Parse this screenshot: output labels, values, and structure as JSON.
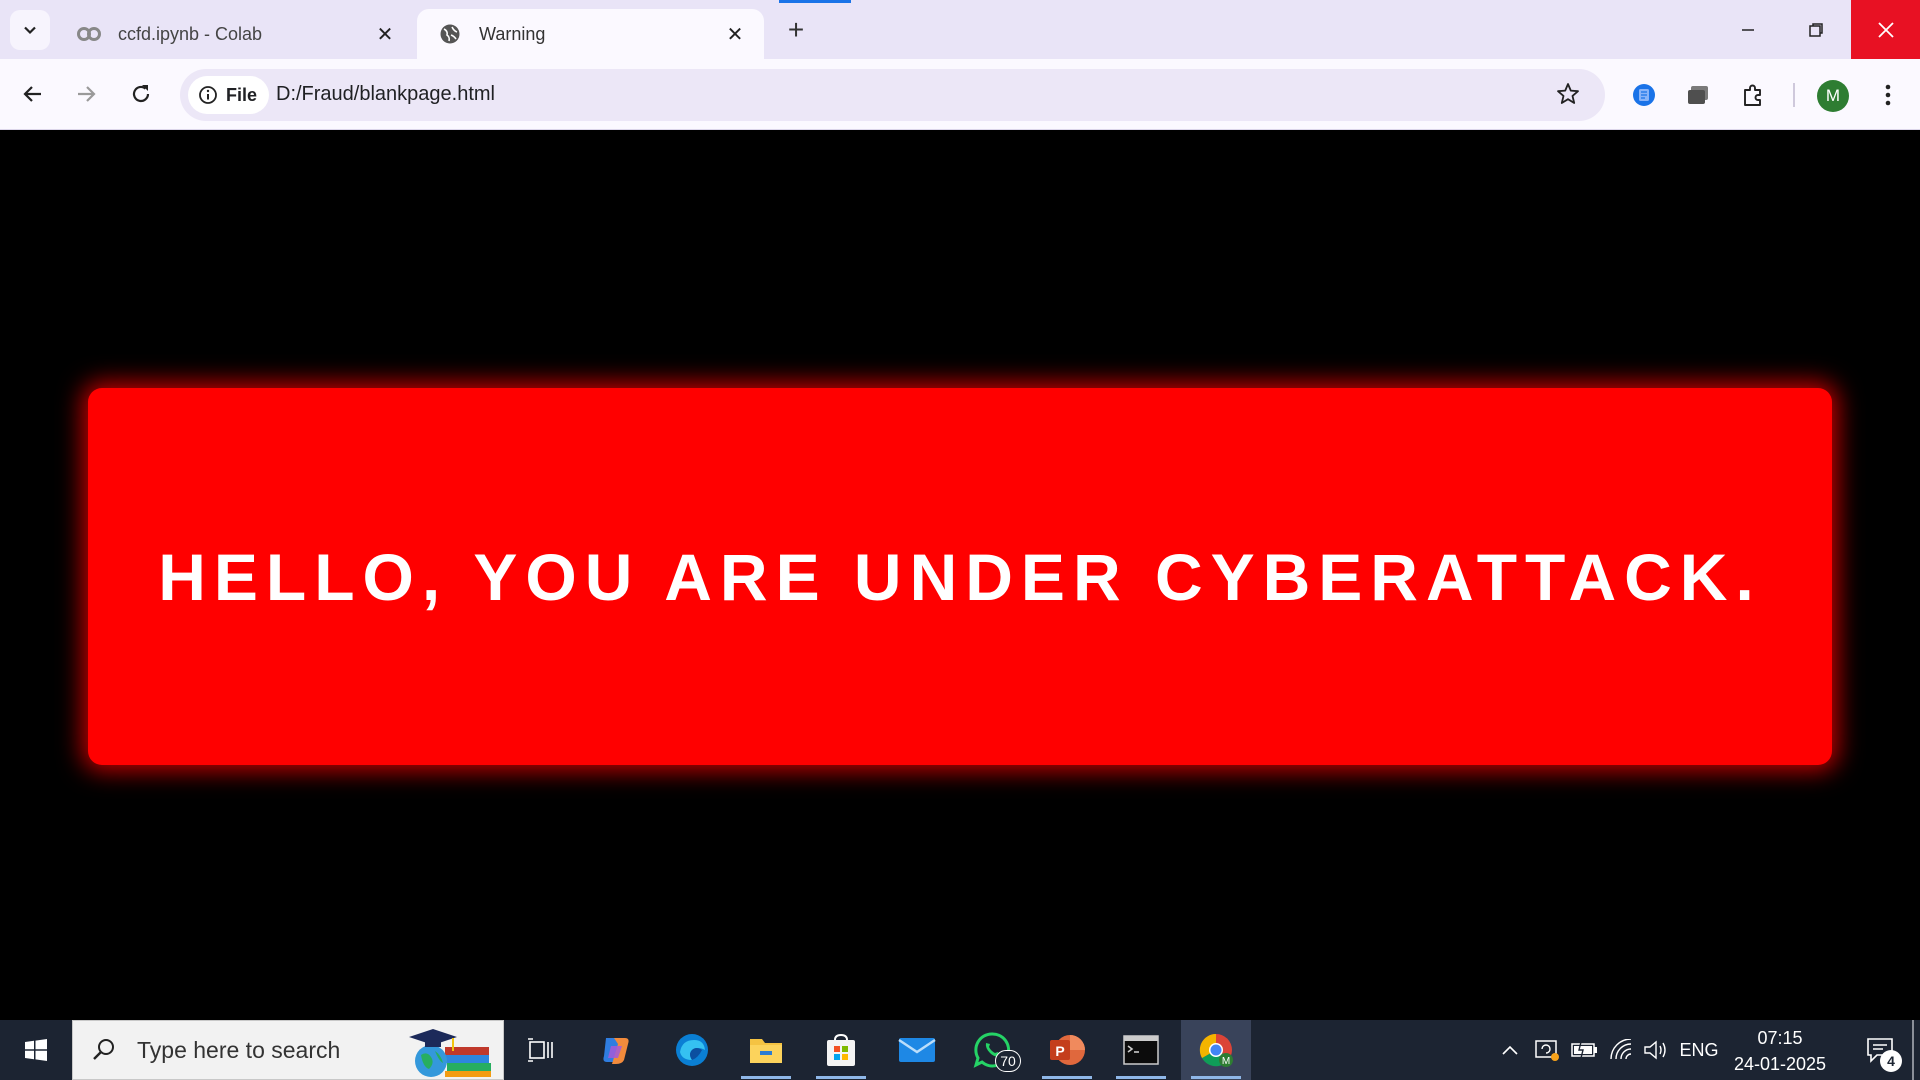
{
  "browser": {
    "tabs": [
      {
        "title": "ccfd.ipynb - Colab",
        "favicon": "colab-icon",
        "active": false
      },
      {
        "title": "Warning",
        "favicon": "globe-icon",
        "active": true
      }
    ],
    "omnibox": {
      "chip_label": "File",
      "url": "D:/Fraud/blankpage.html"
    },
    "profile_initial": "M"
  },
  "page": {
    "warning_text": "HELLO, YOU ARE UNDER CYBERATTACK.",
    "box_color": "#ff0000",
    "background_color": "#000000"
  },
  "taskbar": {
    "search_placeholder": "Type here to search",
    "apps": [
      {
        "name": "task-view-icon"
      },
      {
        "name": "copilot-icon"
      },
      {
        "name": "edge-icon"
      },
      {
        "name": "file-explorer-icon"
      },
      {
        "name": "microsoft-store-icon"
      },
      {
        "name": "mail-icon"
      },
      {
        "name": "whatsapp-icon",
        "badge": "70"
      },
      {
        "name": "powerpoint-icon"
      },
      {
        "name": "terminal-icon"
      },
      {
        "name": "chrome-icon",
        "active": true
      }
    ],
    "tray": {
      "language": "ENG",
      "time": "07:15",
      "date": "24-01-2025",
      "notification_count": "4"
    }
  }
}
